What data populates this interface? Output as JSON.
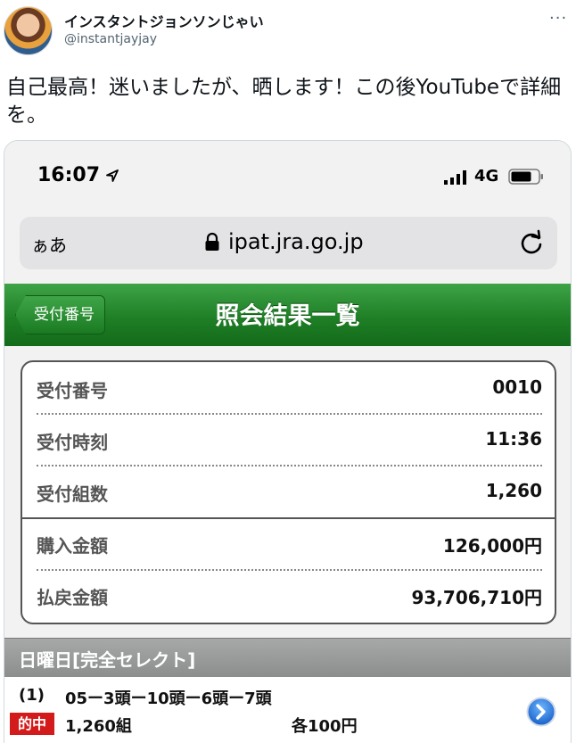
{
  "tweet": {
    "author_name": "インスタントジョンソンじゃい",
    "author_handle": "@instantjayjay",
    "more_label": "···",
    "text": "自己最高！迷いましたが、晒します！この後YouTubeで詳細を。"
  },
  "phone": {
    "status": {
      "time": "16:07",
      "network": "4G"
    },
    "browser": {
      "reader_label": "ぁあ",
      "url": "ipat.jra.go.jp"
    },
    "nav": {
      "back_label": "受付番号",
      "title": "照会結果一覧"
    },
    "summary": [
      {
        "label": "受付番号",
        "value": "0010"
      },
      {
        "label": "受付時刻",
        "value": "11:36"
      },
      {
        "label": "受付組数",
        "value": "1,260"
      },
      {
        "label": "購入金額",
        "value": "126,000円"
      },
      {
        "label": "払戻金額",
        "value": "93,706,710円"
      }
    ],
    "section_title": "日曜日[完全セレクト]",
    "bet": {
      "index": "(1)",
      "combination": "05ー3頭ー10頭ー6頭ー7頭",
      "badge": "的中",
      "count": "1,260組",
      "unit": "各100円"
    }
  },
  "colors": {
    "header_green": "#1f7f26",
    "hit_red": "#d41b1b",
    "section_gray": "#9a9c9b"
  },
  "icons": [
    "location-arrow-icon",
    "signal-bars-icon",
    "battery-icon",
    "lock-icon",
    "reload-icon",
    "chevron-right-circle-icon"
  ]
}
